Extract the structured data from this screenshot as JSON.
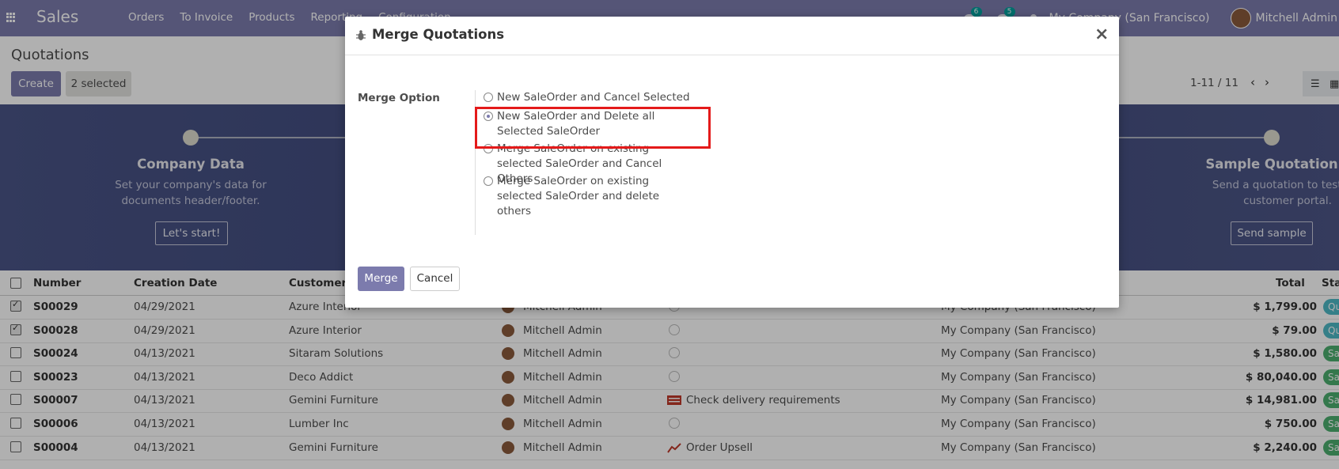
{
  "navbar": {
    "app_name": "Sales",
    "menu": [
      "Orders",
      "To Invoice",
      "Products",
      "Reporting",
      "Configuration"
    ],
    "messages_count": "6",
    "activities_count": "5",
    "company": "My Company (San Francisco)",
    "user": "Mitchell Admin"
  },
  "control_panel": {
    "breadcrumb": "Quotations",
    "create_label": "Create",
    "selected_label": "2 selected",
    "pager": "1-11 / 11"
  },
  "banner": {
    "steps": [
      {
        "title": "Company Data",
        "text_line1": "Set your company's data for",
        "text_line2": "documents header/footer.",
        "button": "Let's start!"
      },
      {
        "title": "Sample Quotation",
        "text_line1": "Send a quotation to test the",
        "text_line2": "customer portal.",
        "button": "Send sample"
      }
    ]
  },
  "list": {
    "headers": {
      "number": "Number",
      "creation_date": "Creation Date",
      "customer": "Customer",
      "total": "Total",
      "status": "Sta"
    },
    "rows": [
      {
        "number": "S00029",
        "date": "04/29/2021",
        "customer": "Azure Interior",
        "salesperson": "Mitchell Admin",
        "activity": "",
        "company": "My Company (San Francisco)",
        "total": "$ 1,799.00",
        "status": "Qu",
        "checked": true
      },
      {
        "number": "S00028",
        "date": "04/29/2021",
        "customer": "Azure Interior",
        "salesperson": "Mitchell Admin",
        "activity": "",
        "company": "My Company (San Francisco)",
        "total": "$ 79.00",
        "status": "Qu",
        "checked": true
      },
      {
        "number": "S00024",
        "date": "04/13/2021",
        "customer": "Sitaram Solutions",
        "salesperson": "Mitchell Admin",
        "activity": "",
        "company": "My Company (San Francisco)",
        "total": "$ 1,580.00",
        "status": "Sa",
        "checked": false
      },
      {
        "number": "S00023",
        "date": "04/13/2021",
        "customer": "Deco Addict",
        "salesperson": "Mitchell Admin",
        "activity": "",
        "company": "My Company (San Francisco)",
        "total": "$ 80,040.00",
        "status": "Sa",
        "checked": false
      },
      {
        "number": "S00007",
        "date": "04/13/2021",
        "customer": "Gemini Furniture",
        "salesperson": "Mitchell Admin",
        "activity": "Check delivery requirements",
        "company": "My Company (San Francisco)",
        "total": "$ 14,981.00",
        "status": "Sa",
        "checked": false
      },
      {
        "number": "S00006",
        "date": "04/13/2021",
        "customer": "Lumber Inc",
        "salesperson": "Mitchell Admin",
        "activity": "",
        "company": "My Company (San Francisco)",
        "total": "$ 750.00",
        "status": "Sa",
        "checked": false
      },
      {
        "number": "S00004",
        "date": "04/13/2021",
        "customer": "Gemini Furniture",
        "salesperson": "Mitchell Admin",
        "activity": "Order Upsell",
        "company": "My Company (San Francisco)",
        "total": "$ 2,240.00",
        "status": "Sa",
        "checked": false
      }
    ]
  },
  "modal": {
    "title": "Merge Quotations",
    "close_label": "×",
    "field_label": "Merge Option",
    "options": [
      {
        "label": "New SaleOrder and Cancel Selected",
        "selected": false
      },
      {
        "label": "New SaleOrder and Delete all Selected SaleOrder",
        "selected": true
      },
      {
        "label": "Merge SaleOrder on existing selected SaleOrder and Cancel Others",
        "selected": false
      },
      {
        "label": "Merge SaleOrder on existing selected SaleOrder and delete others",
        "selected": false
      }
    ],
    "merge_label": "Merge",
    "cancel_label": "Cancel"
  },
  "colors": {
    "brand": "#7c7bad",
    "highlight": "#e41a1a",
    "banner": "#4a5487"
  }
}
